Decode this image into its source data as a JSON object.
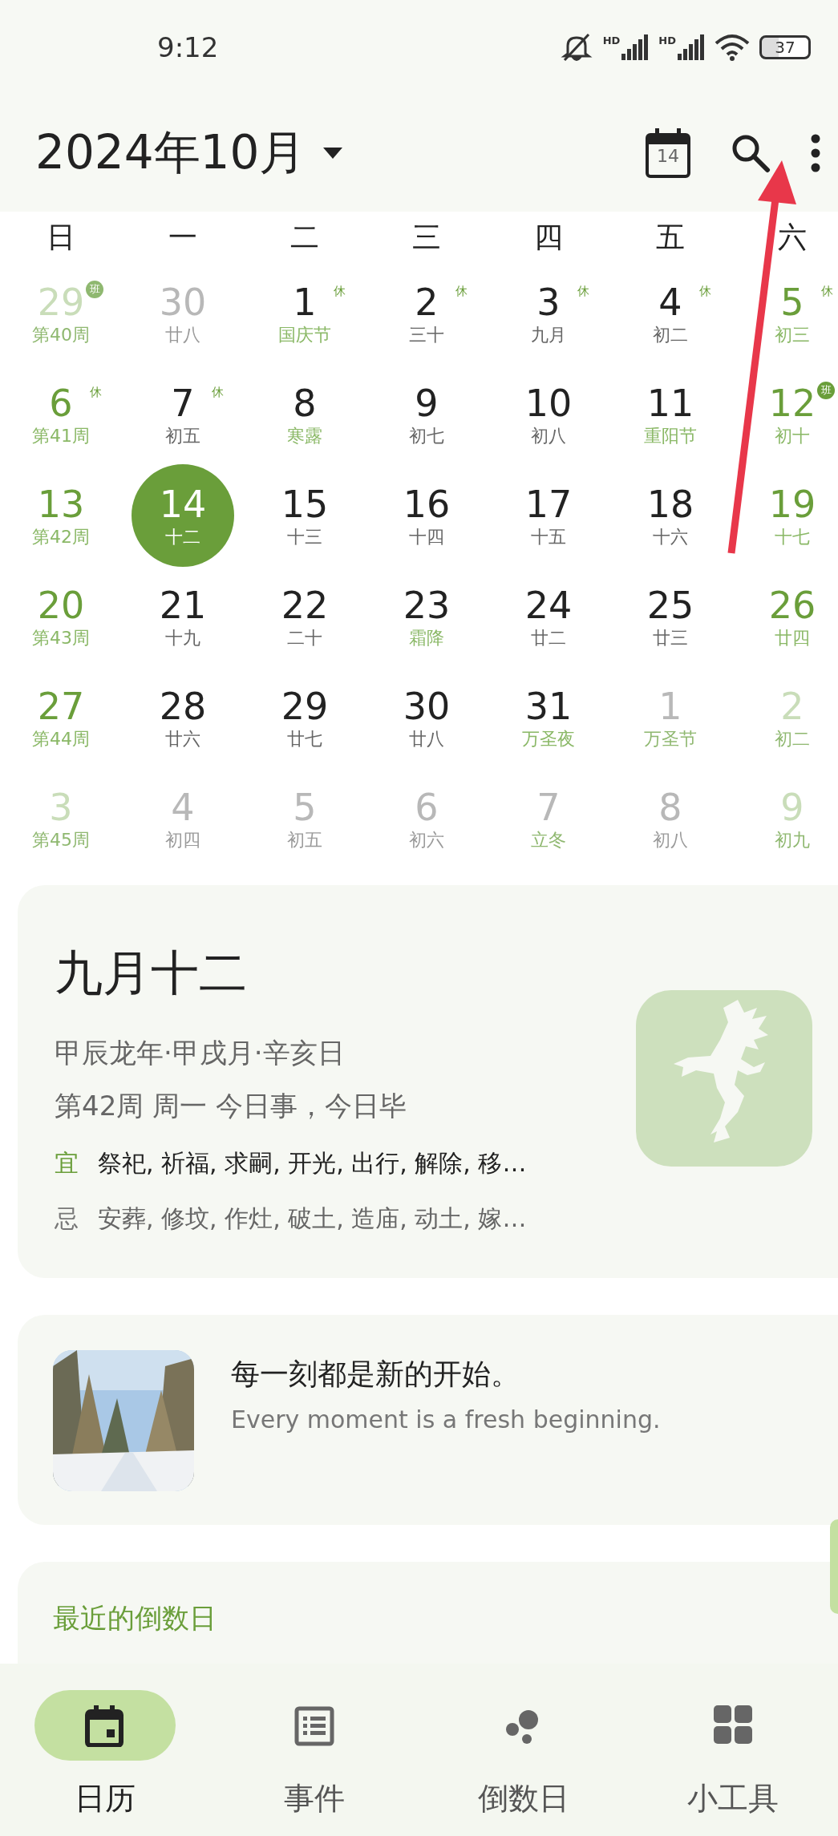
{
  "status_bar": {
    "time": "9:12",
    "signal_labels": [
      "HD",
      "HD"
    ],
    "battery": "37"
  },
  "header": {
    "title": "2024年10月",
    "today_icon_label": "14"
  },
  "weekdays": [
    "日",
    "一",
    "二",
    "三",
    "四",
    "五",
    "六"
  ],
  "weeks": [
    {
      "days": [
        {
          "day": "29",
          "sub": "第40周",
          "highlight_sub": true,
          "in_month": false,
          "weekend": true,
          "badge": "班",
          "badge_circled": true,
          "selected": false
        },
        {
          "day": "30",
          "sub": "廿八",
          "highlight_sub": false,
          "in_month": false,
          "weekend": false,
          "selected": false
        },
        {
          "day": "1",
          "sub": "国庆节",
          "highlight_sub": true,
          "in_month": true,
          "weekend": false,
          "badge": "休",
          "badge_circled": false,
          "selected": false
        },
        {
          "day": "2",
          "sub": "三十",
          "highlight_sub": false,
          "in_month": true,
          "weekend": false,
          "badge": "休",
          "badge_circled": false,
          "selected": false
        },
        {
          "day": "3",
          "sub": "九月",
          "highlight_sub": false,
          "in_month": true,
          "weekend": false,
          "badge": "休",
          "badge_circled": false,
          "selected": false
        },
        {
          "day": "4",
          "sub": "初二",
          "highlight_sub": false,
          "in_month": true,
          "weekend": false,
          "badge": "休",
          "badge_circled": false,
          "selected": false
        },
        {
          "day": "5",
          "sub": "初三",
          "highlight_sub": true,
          "in_month": true,
          "weekend": true,
          "badge": "休",
          "badge_circled": false,
          "selected": false
        }
      ]
    },
    {
      "days": [
        {
          "day": "6",
          "sub": "第41周",
          "highlight_sub": true,
          "in_month": true,
          "weekend": true,
          "badge": "休",
          "badge_circled": false,
          "selected": false
        },
        {
          "day": "7",
          "sub": "初五",
          "highlight_sub": false,
          "in_month": true,
          "weekend": false,
          "badge": "休",
          "badge_circled": false,
          "selected": false
        },
        {
          "day": "8",
          "sub": "寒露",
          "highlight_sub": true,
          "in_month": true,
          "weekend": false,
          "selected": false
        },
        {
          "day": "9",
          "sub": "初七",
          "highlight_sub": false,
          "in_month": true,
          "weekend": false,
          "selected": false
        },
        {
          "day": "10",
          "sub": "初八",
          "highlight_sub": false,
          "in_month": true,
          "weekend": false,
          "selected": false
        },
        {
          "day": "11",
          "sub": "重阳节",
          "highlight_sub": true,
          "in_month": true,
          "weekend": false,
          "selected": false
        },
        {
          "day": "12",
          "sub": "初十",
          "highlight_sub": true,
          "in_month": true,
          "weekend": true,
          "badge": "班",
          "badge_circled": true,
          "selected": false
        }
      ]
    },
    {
      "days": [
        {
          "day": "13",
          "sub": "第42周",
          "highlight_sub": true,
          "in_month": true,
          "weekend": true,
          "selected": false
        },
        {
          "day": "14",
          "sub": "十二",
          "highlight_sub": false,
          "in_month": true,
          "weekend": false,
          "selected": true
        },
        {
          "day": "15",
          "sub": "十三",
          "highlight_sub": false,
          "in_month": true,
          "weekend": false,
          "selected": false
        },
        {
          "day": "16",
          "sub": "十四",
          "highlight_sub": false,
          "in_month": true,
          "weekend": false,
          "selected": false
        },
        {
          "day": "17",
          "sub": "十五",
          "highlight_sub": false,
          "in_month": true,
          "weekend": false,
          "selected": false
        },
        {
          "day": "18",
          "sub": "十六",
          "highlight_sub": false,
          "in_month": true,
          "weekend": false,
          "selected": false
        },
        {
          "day": "19",
          "sub": "十七",
          "highlight_sub": true,
          "in_month": true,
          "weekend": true,
          "selected": false
        }
      ]
    },
    {
      "days": [
        {
          "day": "20",
          "sub": "第43周",
          "highlight_sub": true,
          "in_month": true,
          "weekend": true,
          "selected": false
        },
        {
          "day": "21",
          "sub": "十九",
          "highlight_sub": false,
          "in_month": true,
          "weekend": false,
          "selected": false
        },
        {
          "day": "22",
          "sub": "二十",
          "highlight_sub": false,
          "in_month": true,
          "weekend": false,
          "selected": false
        },
        {
          "day": "23",
          "sub": "霜降",
          "highlight_sub": true,
          "in_month": true,
          "weekend": false,
          "selected": false
        },
        {
          "day": "24",
          "sub": "廿二",
          "highlight_sub": false,
          "in_month": true,
          "weekend": false,
          "selected": false
        },
        {
          "day": "25",
          "sub": "廿三",
          "highlight_sub": false,
          "in_month": true,
          "weekend": false,
          "selected": false
        },
        {
          "day": "26",
          "sub": "廿四",
          "highlight_sub": true,
          "in_month": true,
          "weekend": true,
          "selected": false
        }
      ]
    },
    {
      "days": [
        {
          "day": "27",
          "sub": "第44周",
          "highlight_sub": true,
          "in_month": true,
          "weekend": true,
          "selected": false
        },
        {
          "day": "28",
          "sub": "廿六",
          "highlight_sub": false,
          "in_month": true,
          "weekend": false,
          "selected": false
        },
        {
          "day": "29",
          "sub": "廿七",
          "highlight_sub": false,
          "in_month": true,
          "weekend": false,
          "selected": false
        },
        {
          "day": "30",
          "sub": "廿八",
          "highlight_sub": false,
          "in_month": true,
          "weekend": false,
          "selected": false
        },
        {
          "day": "31",
          "sub": "万圣夜",
          "highlight_sub": true,
          "in_month": true,
          "weekend": false,
          "selected": false
        },
        {
          "day": "1",
          "sub": "万圣节",
          "highlight_sub": true,
          "in_month": false,
          "weekend": false,
          "selected": false
        },
        {
          "day": "2",
          "sub": "初二",
          "highlight_sub": true,
          "in_month": false,
          "weekend": true,
          "selected": false
        }
      ]
    },
    {
      "days": [
        {
          "day": "3",
          "sub": "第45周",
          "highlight_sub": true,
          "in_month": false,
          "weekend": true,
          "selected": false
        },
        {
          "day": "4",
          "sub": "初四",
          "highlight_sub": false,
          "in_month": false,
          "weekend": false,
          "selected": false
        },
        {
          "day": "5",
          "sub": "初五",
          "highlight_sub": false,
          "in_month": false,
          "weekend": false,
          "selected": false
        },
        {
          "day": "6",
          "sub": "初六",
          "highlight_sub": false,
          "in_month": false,
          "weekend": false,
          "selected": false
        },
        {
          "day": "7",
          "sub": "立冬",
          "highlight_sub": true,
          "in_month": false,
          "weekend": false,
          "selected": false
        },
        {
          "day": "8",
          "sub": "初八",
          "highlight_sub": false,
          "in_month": false,
          "weekend": false,
          "selected": false
        },
        {
          "day": "9",
          "sub": "初九",
          "highlight_sub": true,
          "in_month": false,
          "weekend": true,
          "selected": false
        }
      ]
    }
  ],
  "almanac": {
    "lunar_date": "九月十二",
    "ganzhi": "甲辰龙年·甲戌月·辛亥日",
    "week_line": "第42周 周一 今日事，今日毕",
    "rows": [
      {
        "label": "宜",
        "kind": "good",
        "items": "祭祀, 祈福, 求嗣, 开光, 出行, 解除, 移…"
      },
      {
        "label": "忌",
        "kind": "bad",
        "items": "安葬, 修坟, 作灶, 破土, 造庙, 动土, 嫁…"
      }
    ]
  },
  "quote": {
    "text": "每一刻都是新的开始。",
    "translation": "Every moment is a fresh beginning."
  },
  "countdown": {
    "title": "最近的倒数日"
  },
  "bottom_nav": [
    {
      "label": "日历",
      "selected": true
    },
    {
      "label": "事件",
      "selected": false
    },
    {
      "label": "倒数日",
      "selected": false
    },
    {
      "label": "小工具",
      "selected": false
    }
  ]
}
